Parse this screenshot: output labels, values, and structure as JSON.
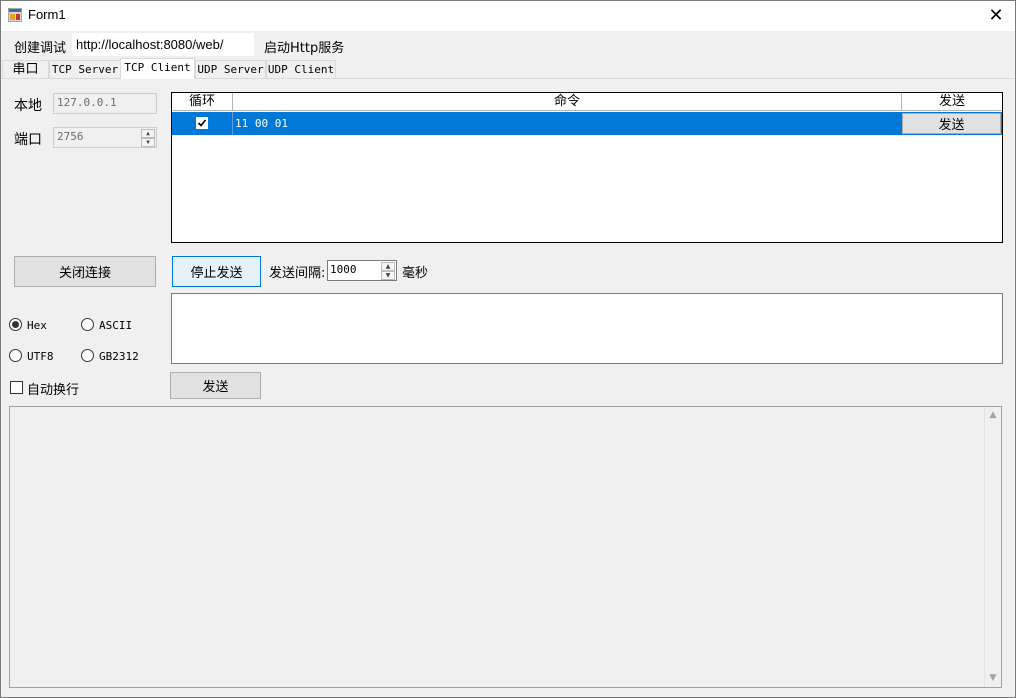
{
  "window": {
    "title": "Form1",
    "close_glyph": "✕"
  },
  "toolbar": {
    "create_debug_label": "创建调试",
    "url_value": "http://localhost:8080/web/",
    "start_http_label": "启动Http服务"
  },
  "tabs": [
    {
      "label": "串口",
      "active": false
    },
    {
      "label": "TCP Server",
      "active": false
    },
    {
      "label": "TCP Client",
      "active": true
    },
    {
      "label": "UDP Server",
      "active": false
    },
    {
      "label": "UDP Client",
      "active": false
    }
  ],
  "connection": {
    "local_label": "本地",
    "local_value": "127.0.0.1",
    "port_label": "端口",
    "port_value": "2756",
    "close_button": "关闭连接"
  },
  "command_grid": {
    "headers": {
      "loop": "循环",
      "command": "命令",
      "send": "发送"
    },
    "rows": [
      {
        "loop": true,
        "command": "11 00 01",
        "send_button": "发送"
      }
    ]
  },
  "send_controls": {
    "stop_button": "停止发送",
    "interval_label": "发送间隔:",
    "interval_value": "1000",
    "unit_label": "毫秒",
    "send_button": "发送"
  },
  "encoding": {
    "options": [
      {
        "label": "Hex",
        "selected": true
      },
      {
        "label": "ASCII",
        "selected": false
      },
      {
        "label": "UTF8",
        "selected": false
      },
      {
        "label": "GB2312",
        "selected": false
      }
    ],
    "auto_wrap_label": "自动换行",
    "auto_wrap_checked": false
  },
  "icons": {
    "checkmark": "check-icon",
    "spin_up": "up-arrow-icon",
    "spin_down": "down-arrow-icon"
  },
  "colors": {
    "selection": "#0078d7",
    "window_bg": "#f0f0f0"
  }
}
